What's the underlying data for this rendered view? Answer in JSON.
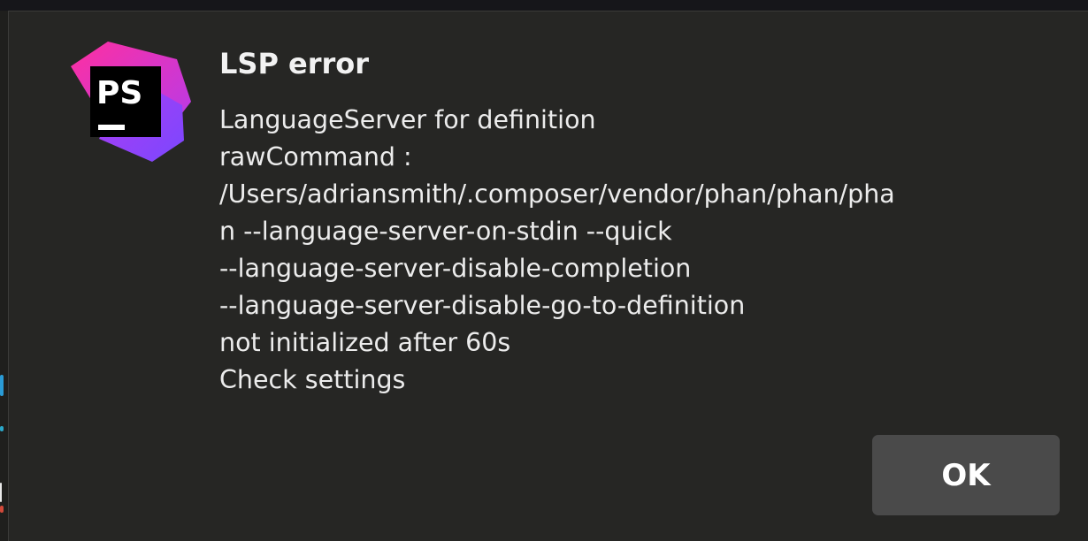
{
  "dialog": {
    "title": "LSP error",
    "message_lines": [
      "LanguageServer for definition",
      "rawCommand :",
      "/Users/adriansmith/.composer/vendor/phan/phan/pha",
      "n --language-server-on-stdin --quick",
      "--language-server-disable-completion",
      "--language-server-disable-go-to-definition",
      "not initialized after 60s",
      "Check settings"
    ],
    "ok_label": "OK"
  },
  "app_icon": {
    "name": "phpstorm-icon",
    "text": "PS",
    "colors": {
      "magenta": "#ff2fa0",
      "purple": "#7b47ff",
      "violet": "#b03cf0",
      "tile": "#000000"
    }
  },
  "colors": {
    "dialog_background": "#262624",
    "button_background": "#4a4a4a",
    "text": "#ececec"
  }
}
